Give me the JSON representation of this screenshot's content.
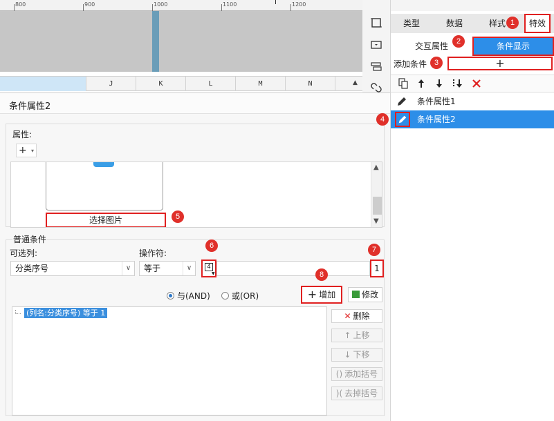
{
  "ruler": {
    "labels": [
      "800",
      "900",
      "1000",
      "1100",
      "1200"
    ]
  },
  "sheet": {
    "columns": [
      "J",
      "K",
      "L",
      "M",
      "N"
    ]
  },
  "right_panel": {
    "top_text": "",
    "tabs": [
      "类型",
      "数据",
      "样式",
      "特效"
    ],
    "subtabs": {
      "interaction": "交互属性",
      "conditional": "条件显示"
    },
    "add_condition_label": "添加条件",
    "add_condition_symbol": "+",
    "toolbar_icons": [
      "copy-icon",
      "arrow-up-icon",
      "arrow-down-icon",
      "move-to-bottom-icon",
      "delete-x-icon"
    ],
    "conditions": [
      "条件属性1",
      "条件属性2"
    ]
  },
  "dialog": {
    "title": "条件属性2",
    "property_label": "属性:",
    "property_add_symbol": "+",
    "choose_image": "选择图片",
    "normal_condition_label": "普通条件",
    "optional_column_label": "可选列:",
    "operator_label": "操作符:",
    "column_value": "分类序号",
    "operator_value": "等于",
    "value_type_symbol": "4",
    "value": "1",
    "radio_and": "与(AND)",
    "radio_or": "或(OR)",
    "add_button": "增加",
    "modify_button": "修改",
    "condition_expression": "(列名:分类序号) 等于 1",
    "side_buttons": [
      "删除",
      "上移",
      "下移",
      "添加括号",
      "去掉括号"
    ]
  },
  "markers": [
    "1",
    "2",
    "3",
    "4",
    "5",
    "6",
    "7",
    "8"
  ],
  "colors": {
    "accent": "#2d8ee8",
    "highlight": "#e02020",
    "marker": "#e0302a"
  }
}
